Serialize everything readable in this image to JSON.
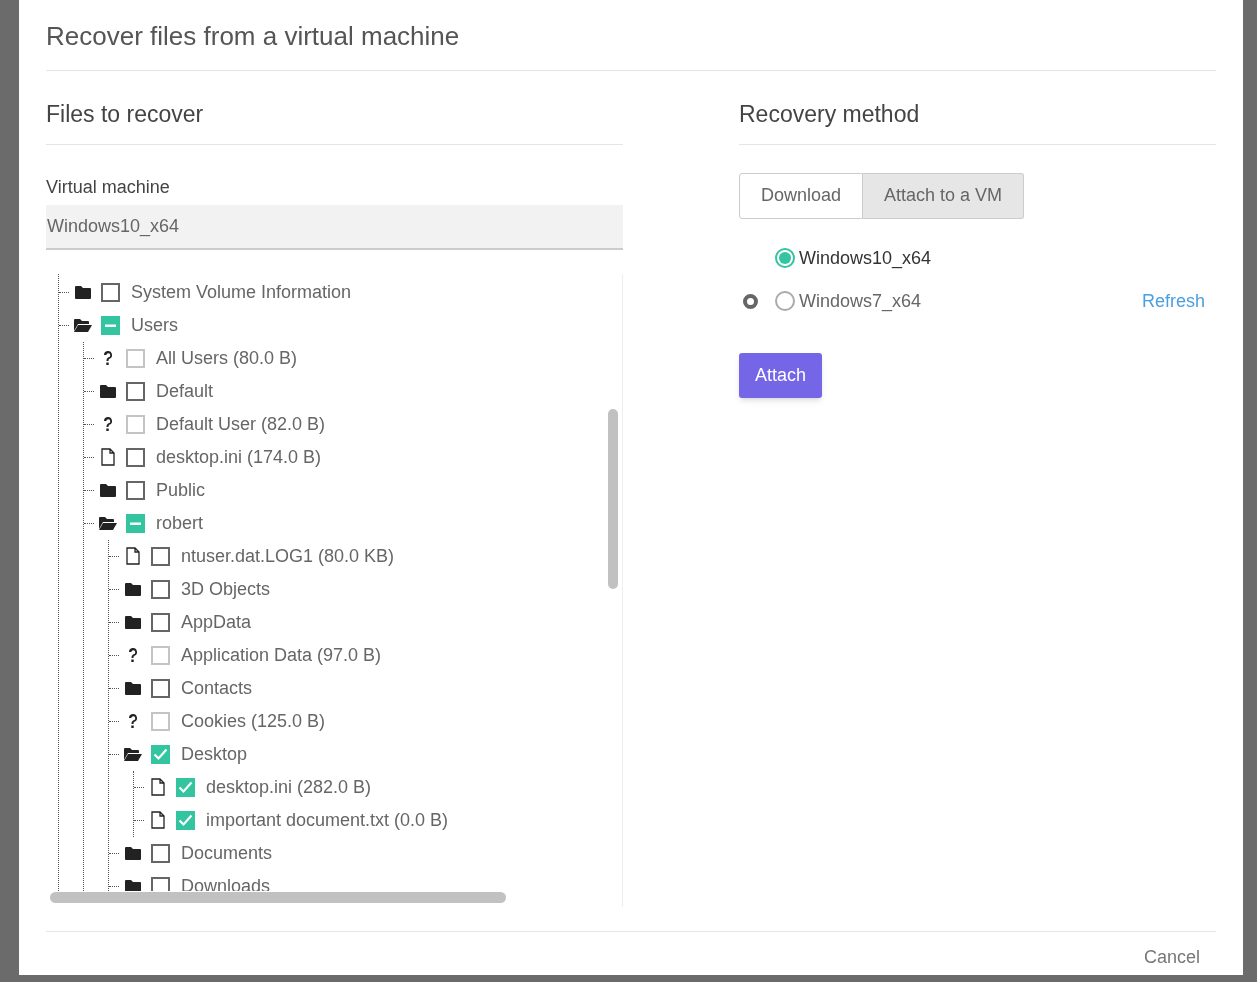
{
  "dialog": {
    "title": "Recover files from a virtual machine"
  },
  "files_section": {
    "heading": "Files to recover",
    "vm_label": "Virtual machine",
    "vm_value": "Windows10_x64",
    "tree": [
      {
        "kind": "folder",
        "label": "System Volume Information",
        "checked": false,
        "partial": false,
        "expanded": false
      },
      {
        "kind": "folder",
        "label": "Users",
        "checked": false,
        "partial": true,
        "expanded": true,
        "children": [
          {
            "kind": "unknown",
            "label": "All Users (80.0 B)",
            "checked": false,
            "partial": false,
            "disabled": true
          },
          {
            "kind": "folder",
            "label": "Default",
            "checked": false,
            "partial": false,
            "expanded": false
          },
          {
            "kind": "unknown",
            "label": "Default User (82.0 B)",
            "checked": false,
            "partial": false,
            "disabled": true
          },
          {
            "kind": "file",
            "label": "desktop.ini (174.0 B)",
            "checked": false,
            "partial": false
          },
          {
            "kind": "folder",
            "label": "Public",
            "checked": false,
            "partial": false,
            "expanded": false
          },
          {
            "kind": "folder",
            "label": "robert",
            "checked": false,
            "partial": true,
            "expanded": true,
            "children": [
              {
                "kind": "file",
                "label": "ntuser.dat.LOG1 (80.0 KB)",
                "checked": false,
                "partial": false
              },
              {
                "kind": "folder",
                "label": "3D Objects",
                "checked": false,
                "partial": false,
                "expanded": false
              },
              {
                "kind": "folder",
                "label": "AppData",
                "checked": false,
                "partial": false,
                "expanded": false
              },
              {
                "kind": "unknown",
                "label": "Application Data (97.0 B)",
                "checked": false,
                "partial": false,
                "disabled": true
              },
              {
                "kind": "folder",
                "label": "Contacts",
                "checked": false,
                "partial": false,
                "expanded": false
              },
              {
                "kind": "unknown",
                "label": "Cookies (125.0 B)",
                "checked": false,
                "partial": false,
                "disabled": true
              },
              {
                "kind": "folder",
                "label": "Desktop",
                "checked": true,
                "partial": false,
                "expanded": true,
                "children": [
                  {
                    "kind": "file",
                    "label": "desktop.ini (282.0 B)",
                    "checked": true,
                    "partial": false
                  },
                  {
                    "kind": "file",
                    "label": "important document.txt (0.0 B)",
                    "checked": true,
                    "partial": false
                  }
                ]
              },
              {
                "kind": "folder",
                "label": "Documents",
                "checked": false,
                "partial": false,
                "expanded": false
              },
              {
                "kind": "folder",
                "label": "Downloads",
                "checked": false,
                "partial": false,
                "expanded": false
              }
            ]
          }
        ]
      }
    ]
  },
  "recovery_section": {
    "heading": "Recovery method",
    "methods": [
      {
        "label": "Download",
        "selected": false
      },
      {
        "label": "Attach to a VM",
        "selected": true
      }
    ],
    "vms": [
      {
        "label": "Windows10_x64",
        "selected": true,
        "indicator": false
      },
      {
        "label": "Windows7_x64",
        "selected": false,
        "indicator": true
      }
    ],
    "refresh_link": "Refresh",
    "attach_button": "Attach"
  },
  "footer": {
    "cancel_button": "Cancel"
  }
}
